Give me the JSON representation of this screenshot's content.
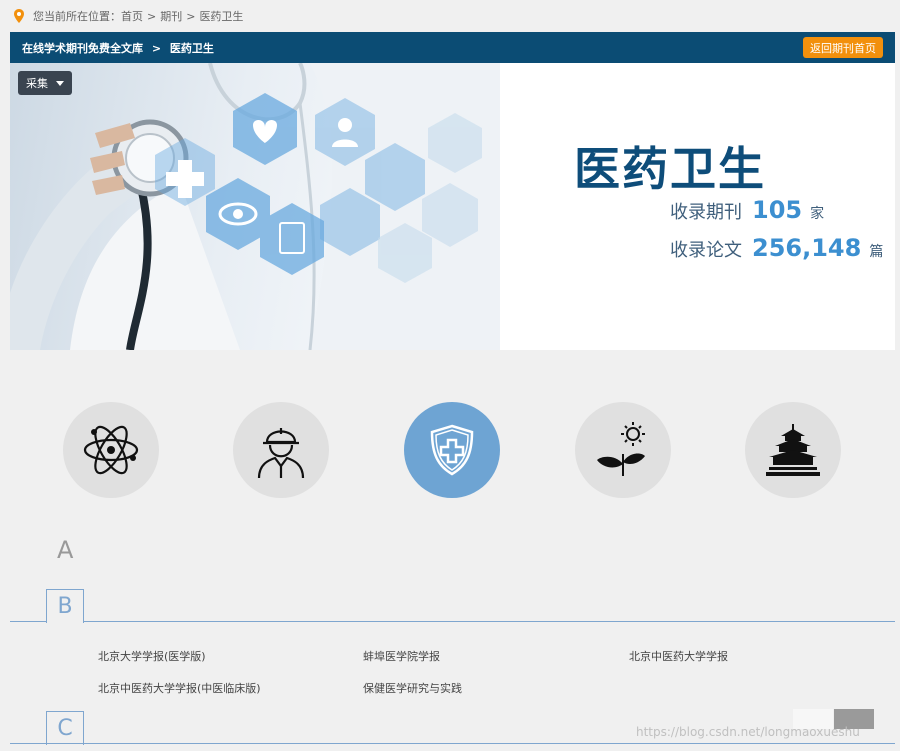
{
  "breadcrumb": {
    "prefix": "您当前所在位置：",
    "items": [
      "首页",
      "期刊",
      "医药卫生"
    ],
    "sep": ">"
  },
  "topbar": {
    "site": "在线学术期刊免费全文库",
    "sep": ">",
    "current": "医药卫生",
    "back_label": "返回期刊首页"
  },
  "banner": {
    "collect_label": "采集",
    "title": "医药卫生",
    "journals_label": "收录期刊",
    "journals_count": "105",
    "journals_unit": "家",
    "papers_label": "收录论文",
    "papers_count": "256,148",
    "papers_unit": "篇"
  },
  "categories": [
    {
      "icon": "atom-icon",
      "active": false
    },
    {
      "icon": "engineer-icon",
      "active": false
    },
    {
      "icon": "medical-shield-icon",
      "active": true
    },
    {
      "icon": "plant-sun-icon",
      "active": false
    },
    {
      "icon": "temple-icon",
      "active": false
    }
  ],
  "sections": {
    "a_letter": "A",
    "b_letter": "B",
    "c_letter": "C",
    "b_journals": [
      "北京大学学报(医学版)",
      "蚌埠医学院学报",
      "北京中医药大学学报",
      "北京中医药大学学报(中医临床版)",
      "保健医学研究与实践"
    ]
  },
  "watermark": "https://blog.csdn.net/longmaoxueshu",
  "colors": {
    "topbar": "#0b4c74",
    "accent_orange": "#f2900d",
    "active_circle": "#6ea4d3",
    "title_blue": "#0e4d7a",
    "number_blue": "#3c8fd0"
  }
}
